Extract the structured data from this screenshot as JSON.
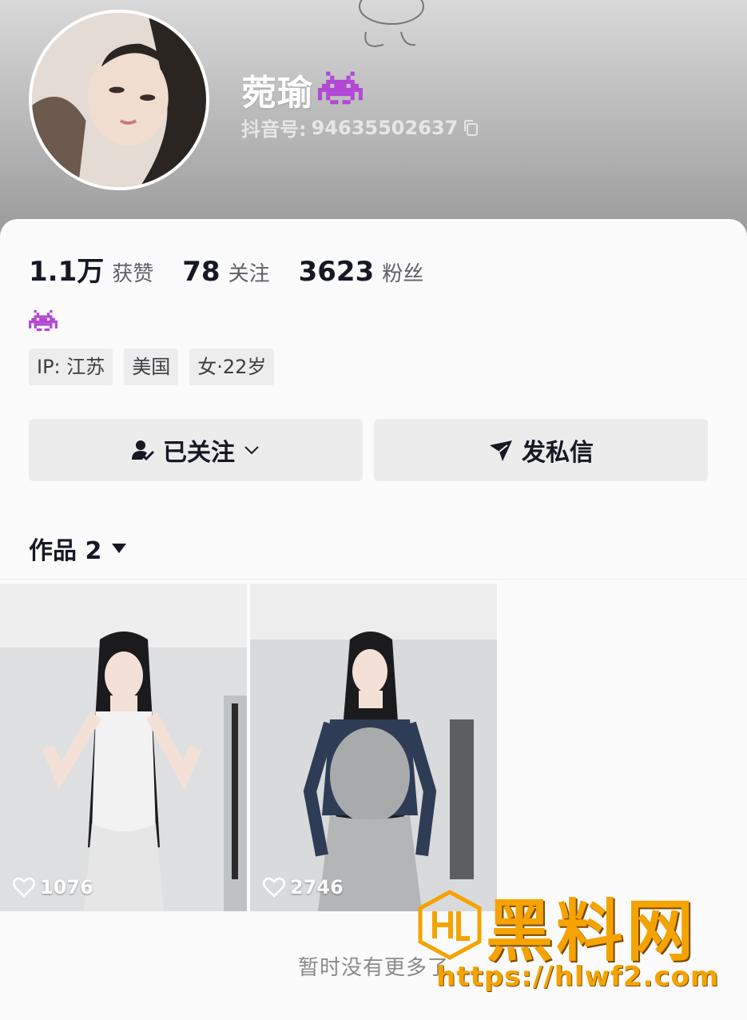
{
  "profile": {
    "nickname": "菀瑜",
    "douyin_id_label": "抖音号:",
    "douyin_id": "94635502637"
  },
  "stats": [
    {
      "value": "1.1万",
      "label": "获赞"
    },
    {
      "value": "78",
      "label": "关注"
    },
    {
      "value": "3623",
      "label": "粉丝"
    }
  ],
  "tags": [
    "IP: 江苏",
    "美国",
    "女·22岁"
  ],
  "actions": {
    "follow_label": "已关注",
    "message_label": "发私信"
  },
  "works": {
    "tab_label": "作品 2",
    "items": [
      {
        "likes": "1076"
      },
      {
        "likes": "2746"
      }
    ],
    "no_more_text": "暂时没有更多了"
  },
  "watermark": {
    "title": "黑料网",
    "url": "https://hlwf2.com"
  },
  "colors": {
    "alien": "#b247d6",
    "watermark": "#f5a300"
  },
  "icons": [
    "copy-icon",
    "user-check-icon",
    "chevron-down-icon",
    "send-icon",
    "triangle-down-icon",
    "heart-icon",
    "alien-emoji-icon"
  ]
}
